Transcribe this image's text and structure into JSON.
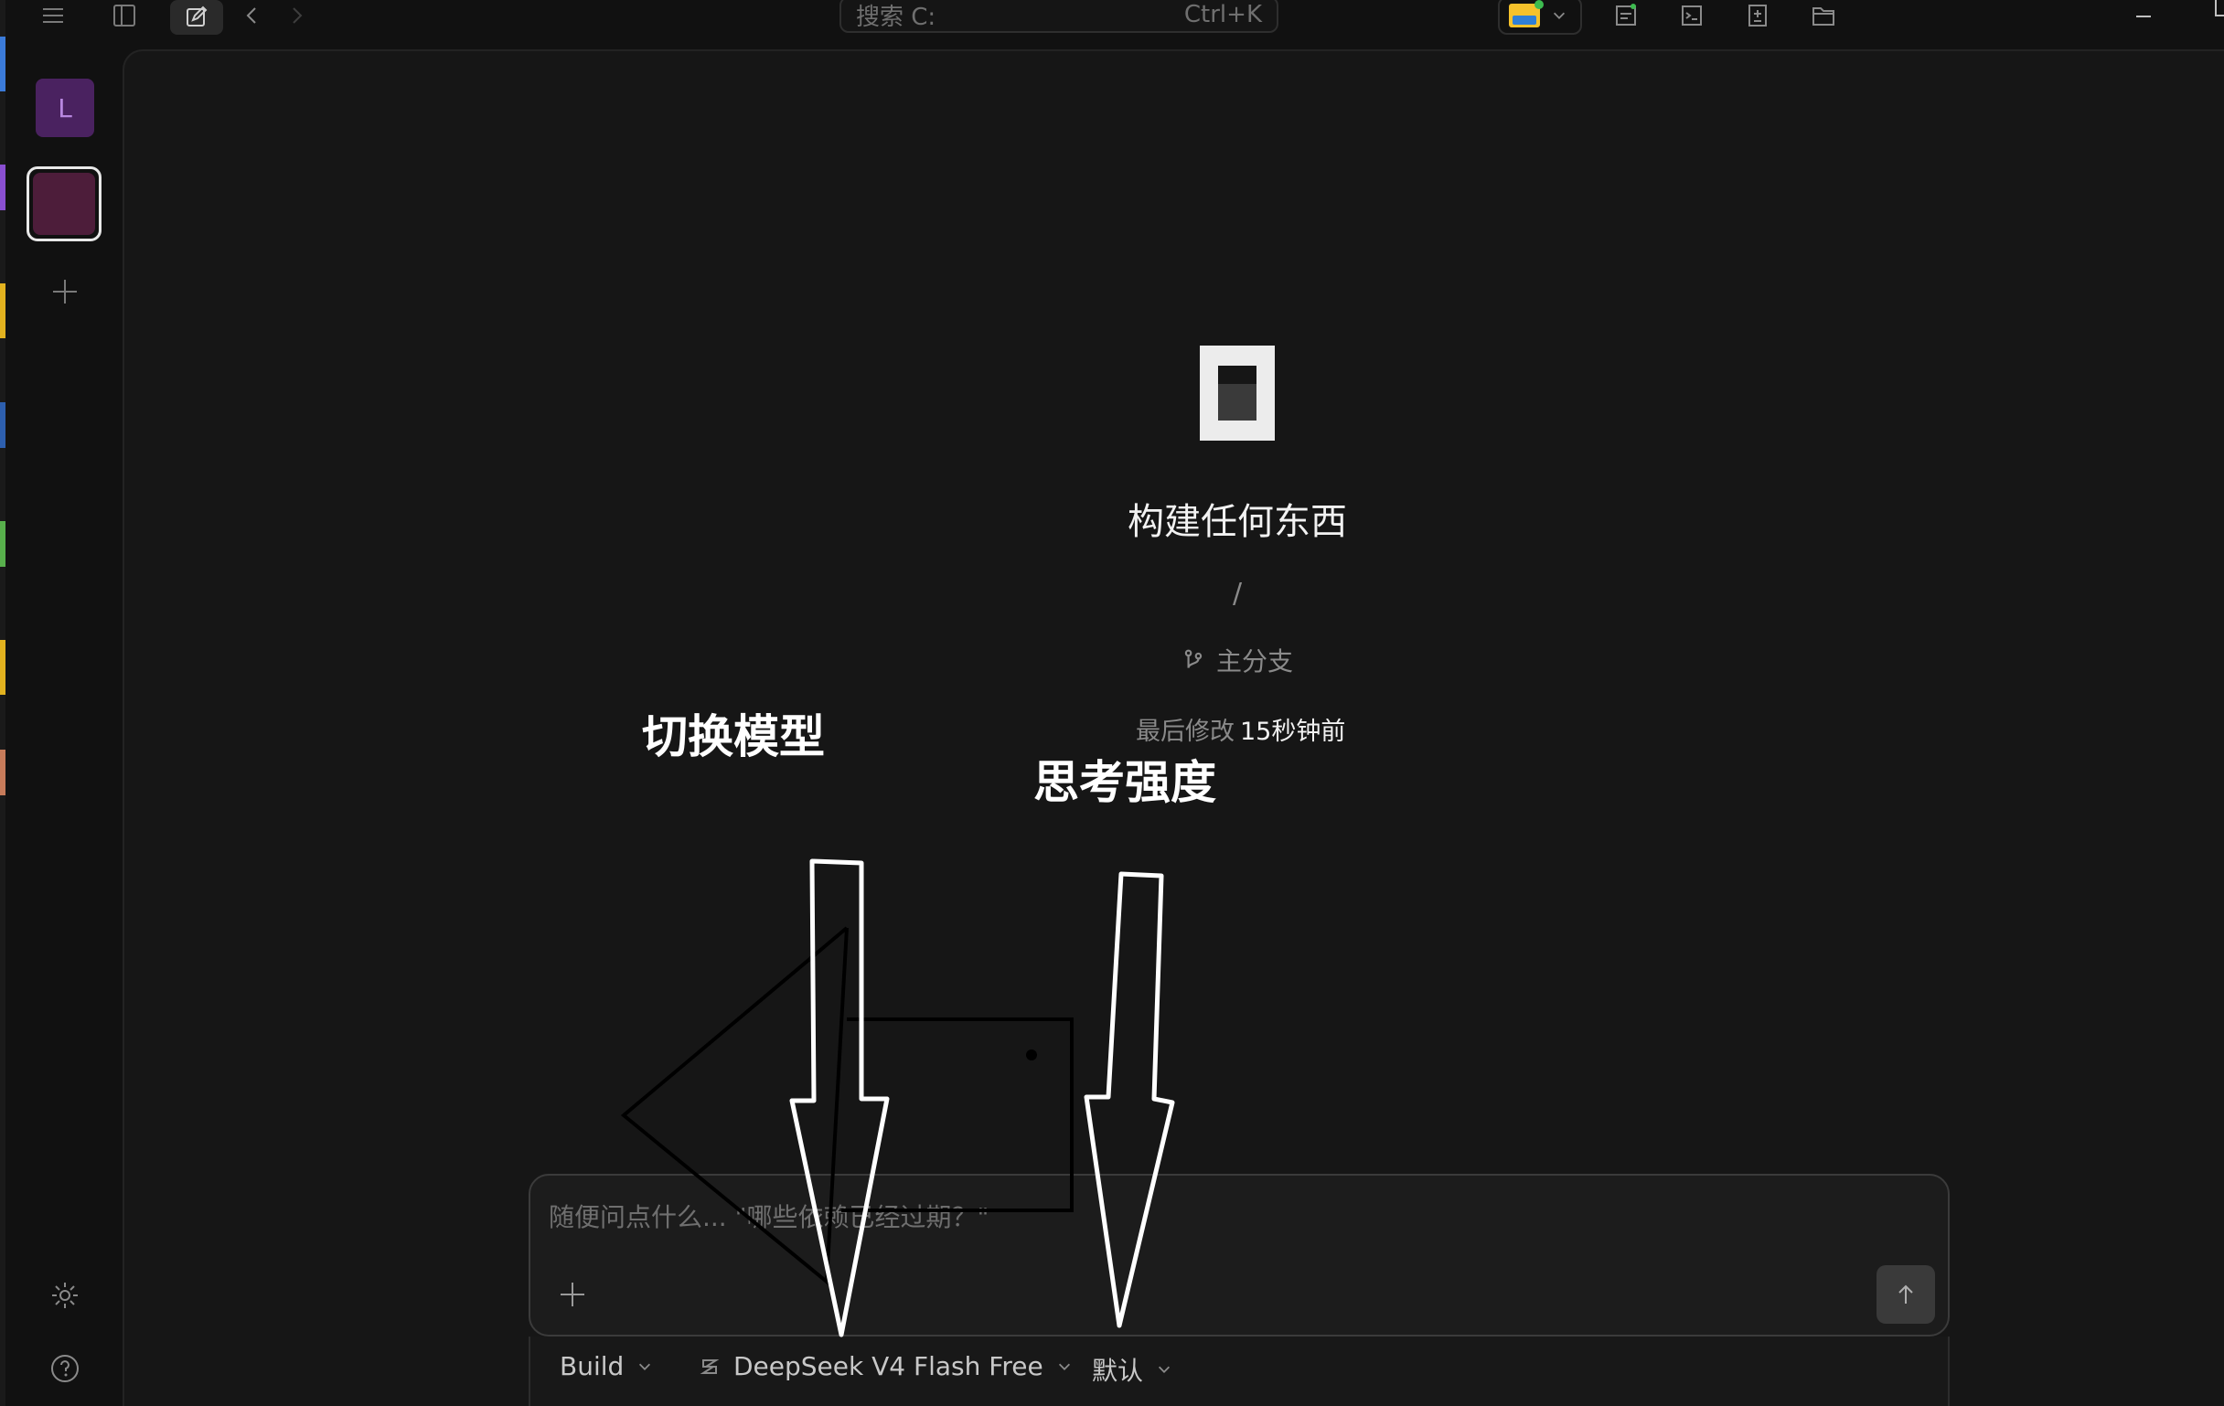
{
  "titlebar": {
    "search_placeholder": "搜索 C:",
    "search_shortcut": "Ctrl+K"
  },
  "sidebar": {
    "project_initial": "L"
  },
  "main": {
    "headline": "构建任何东西",
    "path": "/",
    "branch": "主分支",
    "last_modified_label": "最后修改",
    "last_modified_value": "15秒钟前"
  },
  "annotations": {
    "switch_model": "切换模型",
    "thinking_strength": "思考强度"
  },
  "composer": {
    "placeholder": "随便问点什么... \"哪些依赖已经过期？\""
  },
  "footer": {
    "mode": "Build",
    "model": "DeepSeek V4 Flash Free",
    "variant": "默认"
  },
  "colors": {
    "background": "#111111",
    "panel": "#161616",
    "project_avatar": "#4a2260",
    "project_selected": "#4d1d3a",
    "annotation": "#ffffff"
  },
  "icons": [
    "menu-icon",
    "sidebar-toggle-icon",
    "new-chat-icon",
    "back-icon",
    "forward-icon",
    "folder-icon",
    "chevron-down-icon",
    "review-icon",
    "terminal-icon",
    "file-diff-icon",
    "files-icon",
    "minimize-icon",
    "plus-icon",
    "gear-icon",
    "help-icon",
    "branch-icon",
    "send-icon",
    "model-icon"
  ]
}
